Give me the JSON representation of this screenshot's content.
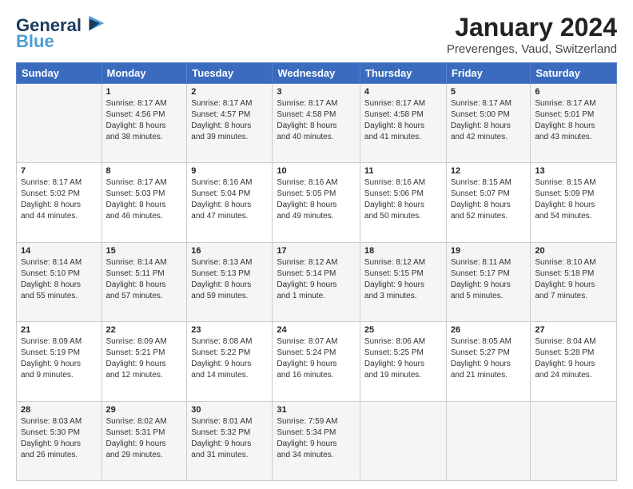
{
  "logo": {
    "line1": "General",
    "line2": "Blue"
  },
  "title": "January 2024",
  "subtitle": "Preverenges, Vaud, Switzerland",
  "columns": [
    "Sunday",
    "Monday",
    "Tuesday",
    "Wednesday",
    "Thursday",
    "Friday",
    "Saturday"
  ],
  "weeks": [
    [
      {
        "day": "",
        "info": ""
      },
      {
        "day": "1",
        "info": "Sunrise: 8:17 AM\nSunset: 4:56 PM\nDaylight: 8 hours\nand 38 minutes."
      },
      {
        "day": "2",
        "info": "Sunrise: 8:17 AM\nSunset: 4:57 PM\nDaylight: 8 hours\nand 39 minutes."
      },
      {
        "day": "3",
        "info": "Sunrise: 8:17 AM\nSunset: 4:58 PM\nDaylight: 8 hours\nand 40 minutes."
      },
      {
        "day": "4",
        "info": "Sunrise: 8:17 AM\nSunset: 4:58 PM\nDaylight: 8 hours\nand 41 minutes."
      },
      {
        "day": "5",
        "info": "Sunrise: 8:17 AM\nSunset: 5:00 PM\nDaylight: 8 hours\nand 42 minutes."
      },
      {
        "day": "6",
        "info": "Sunrise: 8:17 AM\nSunset: 5:01 PM\nDaylight: 8 hours\nand 43 minutes."
      }
    ],
    [
      {
        "day": "7",
        "info": "Sunrise: 8:17 AM\nSunset: 5:02 PM\nDaylight: 8 hours\nand 44 minutes."
      },
      {
        "day": "8",
        "info": "Sunrise: 8:17 AM\nSunset: 5:03 PM\nDaylight: 8 hours\nand 46 minutes."
      },
      {
        "day": "9",
        "info": "Sunrise: 8:16 AM\nSunset: 5:04 PM\nDaylight: 8 hours\nand 47 minutes."
      },
      {
        "day": "10",
        "info": "Sunrise: 8:16 AM\nSunset: 5:05 PM\nDaylight: 8 hours\nand 49 minutes."
      },
      {
        "day": "11",
        "info": "Sunrise: 8:16 AM\nSunset: 5:06 PM\nDaylight: 8 hours\nand 50 minutes."
      },
      {
        "day": "12",
        "info": "Sunrise: 8:15 AM\nSunset: 5:07 PM\nDaylight: 8 hours\nand 52 minutes."
      },
      {
        "day": "13",
        "info": "Sunrise: 8:15 AM\nSunset: 5:09 PM\nDaylight: 8 hours\nand 54 minutes."
      }
    ],
    [
      {
        "day": "14",
        "info": "Sunrise: 8:14 AM\nSunset: 5:10 PM\nDaylight: 8 hours\nand 55 minutes."
      },
      {
        "day": "15",
        "info": "Sunrise: 8:14 AM\nSunset: 5:11 PM\nDaylight: 8 hours\nand 57 minutes."
      },
      {
        "day": "16",
        "info": "Sunrise: 8:13 AM\nSunset: 5:13 PM\nDaylight: 8 hours\nand 59 minutes."
      },
      {
        "day": "17",
        "info": "Sunrise: 8:12 AM\nSunset: 5:14 PM\nDaylight: 9 hours\nand 1 minute."
      },
      {
        "day": "18",
        "info": "Sunrise: 8:12 AM\nSunset: 5:15 PM\nDaylight: 9 hours\nand 3 minutes."
      },
      {
        "day": "19",
        "info": "Sunrise: 8:11 AM\nSunset: 5:17 PM\nDaylight: 9 hours\nand 5 minutes."
      },
      {
        "day": "20",
        "info": "Sunrise: 8:10 AM\nSunset: 5:18 PM\nDaylight: 9 hours\nand 7 minutes."
      }
    ],
    [
      {
        "day": "21",
        "info": "Sunrise: 8:09 AM\nSunset: 5:19 PM\nDaylight: 9 hours\nand 9 minutes."
      },
      {
        "day": "22",
        "info": "Sunrise: 8:09 AM\nSunset: 5:21 PM\nDaylight: 9 hours\nand 12 minutes."
      },
      {
        "day": "23",
        "info": "Sunrise: 8:08 AM\nSunset: 5:22 PM\nDaylight: 9 hours\nand 14 minutes."
      },
      {
        "day": "24",
        "info": "Sunrise: 8:07 AM\nSunset: 5:24 PM\nDaylight: 9 hours\nand 16 minutes."
      },
      {
        "day": "25",
        "info": "Sunrise: 8:06 AM\nSunset: 5:25 PM\nDaylight: 9 hours\nand 19 minutes."
      },
      {
        "day": "26",
        "info": "Sunrise: 8:05 AM\nSunset: 5:27 PM\nDaylight: 9 hours\nand 21 minutes."
      },
      {
        "day": "27",
        "info": "Sunrise: 8:04 AM\nSunset: 5:28 PM\nDaylight: 9 hours\nand 24 minutes."
      }
    ],
    [
      {
        "day": "28",
        "info": "Sunrise: 8:03 AM\nSunset: 5:30 PM\nDaylight: 9 hours\nand 26 minutes."
      },
      {
        "day": "29",
        "info": "Sunrise: 8:02 AM\nSunset: 5:31 PM\nDaylight: 9 hours\nand 29 minutes."
      },
      {
        "day": "30",
        "info": "Sunrise: 8:01 AM\nSunset: 5:32 PM\nDaylight: 9 hours\nand 31 minutes."
      },
      {
        "day": "31",
        "info": "Sunrise: 7:59 AM\nSunset: 5:34 PM\nDaylight: 9 hours\nand 34 minutes."
      },
      {
        "day": "",
        "info": ""
      },
      {
        "day": "",
        "info": ""
      },
      {
        "day": "",
        "info": ""
      }
    ]
  ]
}
